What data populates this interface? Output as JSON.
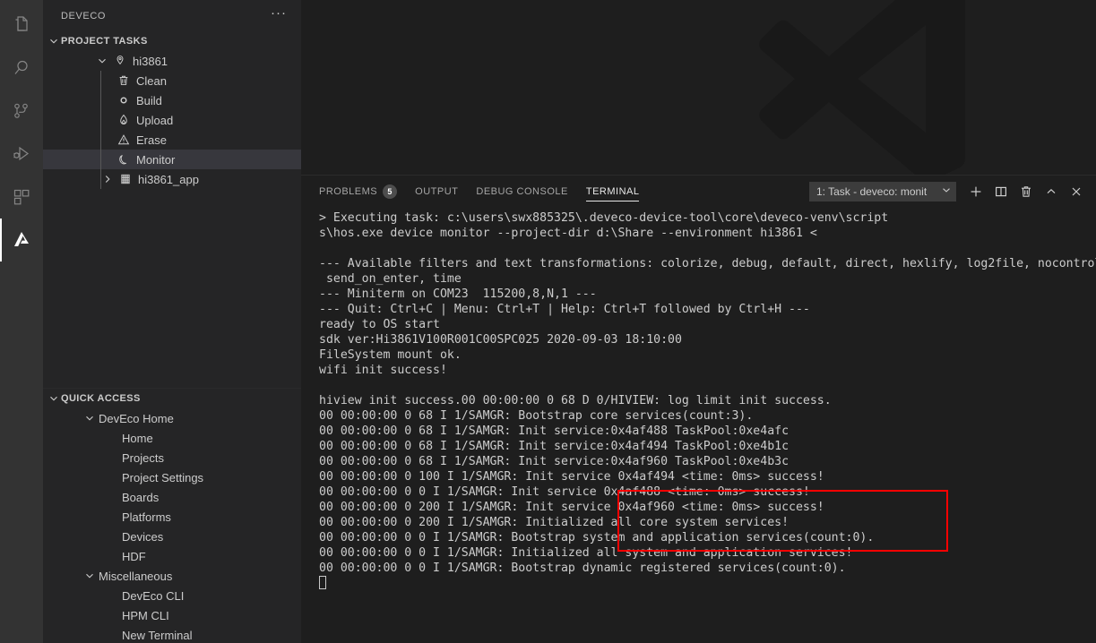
{
  "activitybar": {
    "items": [
      {
        "name": "explorer-icon",
        "title": "Explorer"
      },
      {
        "name": "search-icon",
        "title": "Search"
      },
      {
        "name": "source-control-icon",
        "title": "Source Control"
      },
      {
        "name": "run-and-debug-icon",
        "title": "Run and Debug"
      },
      {
        "name": "extensions-icon",
        "title": "Extensions"
      },
      {
        "name": "deveco-icon",
        "title": "DevEco",
        "active": true
      }
    ]
  },
  "sidebar": {
    "title": "DEVECO",
    "more_actions": "···",
    "project_tasks": {
      "header": "PROJECT TASKS",
      "root": {
        "label": "hi3861",
        "icon": "location-pin-icon"
      },
      "tasks": [
        {
          "label": "Clean",
          "icon": "trash-icon"
        },
        {
          "label": "Build",
          "icon": "circle-icon"
        },
        {
          "label": "Upload",
          "icon": "flame-icon"
        },
        {
          "label": "Erase",
          "icon": "warning-triangle-icon"
        },
        {
          "label": "Monitor",
          "icon": "moon-icon",
          "selected": true
        }
      ],
      "app_node": {
        "label": "hi3861_app",
        "icon": "chip-icon"
      }
    },
    "quick_access": {
      "header": "QUICK ACCESS",
      "groups": [
        {
          "label": "DevEco Home",
          "items": [
            "Home",
            "Projects",
            "Project Settings",
            "Boards",
            "Platforms",
            "Devices",
            "HDF"
          ]
        },
        {
          "label": "Miscellaneous",
          "items": [
            "DevEco CLI",
            "HPM CLI",
            "New Terminal"
          ]
        }
      ]
    }
  },
  "panel": {
    "tabs": [
      {
        "label": "PROBLEMS",
        "badge": "5",
        "active": false
      },
      {
        "label": "OUTPUT",
        "badge": null,
        "active": false
      },
      {
        "label": "DEBUG CONSOLE",
        "badge": null,
        "active": false
      },
      {
        "label": "TERMINAL",
        "badge": null,
        "active": true
      }
    ],
    "terminal_select": "1: Task - deveco: monit",
    "actions": [
      {
        "name": "new-terminal-icon",
        "label": "+"
      },
      {
        "name": "split-terminal-icon",
        "label": "◫"
      },
      {
        "name": "kill-terminal-icon",
        "label": "🗑"
      },
      {
        "name": "maximize-panel-icon",
        "label": "^"
      },
      {
        "name": "close-panel-icon",
        "label": "×"
      }
    ]
  },
  "terminal": {
    "lines": [
      "> Executing task: c:\\users\\swx885325\\.deveco-device-tool\\core\\deveco-venv\\script",
      "s\\hos.exe device monitor --project-dir d:\\Share --environment hi3861 <",
      "",
      "--- Available filters and text transformations: colorize, debug, default, direct, hexlify, log2file, nocontrol, printable,",
      " send_on_enter, time",
      "--- Miniterm on COM23  115200,8,N,1 ---",
      "--- Quit: Ctrl+C | Menu: Ctrl+T | Help: Ctrl+T followed by Ctrl+H ---",
      "ready to OS start",
      "sdk ver:Hi3861V100R001C00SPC025 2020-09-03 18:10:00",
      "FileSystem mount ok.",
      "wifi init success!",
      "",
      "hiview init success.00 00:00:00 0 68 D 0/HIVIEW: log limit init success.",
      "00 00:00:00 0 68 I 1/SAMGR: Bootstrap core services(count:3).",
      "00 00:00:00 0 68 I 1/SAMGR: Init service:0x4af488 TaskPool:0xe4afc",
      "00 00:00:00 0 68 I 1/SAMGR: Init service:0x4af494 TaskPool:0xe4b1c",
      "00 00:00:00 0 68 I 1/SAMGR: Init service:0x4af960 TaskPool:0xe4b3c",
      "00 00:00:00 0 100 I 1/SAMGR: Init service 0x4af494 <time: 0ms> success!",
      "00 00:00:00 0 0 I 1/SAMGR: Init service 0x4af488 <time: 0ms> success!",
      "00 00:00:00 0 200 I 1/SAMGR: Init service 0x4af960 <time: 0ms> success!",
      "00 00:00:00 0 200 I 1/SAMGR: Initialized all core system services!",
      "00 00:00:00 0 0 I 1/SAMGR: Bootstrap system and application services(count:0).",
      "00 00:00:00 0 0 I 1/SAMGR: Initialized all system and application services!",
      "00 00:00:00 0 0 I 1/SAMGR: Bootstrap dynamic registered services(count:0)."
    ],
    "highlight_annotation": {
      "color": "#ff0000",
      "lines": [
        "ready to OS start",
        "sdk ver:Hi3861V100R001C00SPC025 2020-09-03 18:10:00",
        "FileSystem mount ok.",
        "wifi init success!"
      ]
    }
  },
  "colors": {
    "activitybar_bg": "#333333",
    "sidebar_bg": "#252526",
    "editor_bg": "#1e1e1e",
    "selection_bg": "#37373d",
    "accent": "#ffffff",
    "annotation_red": "#ff0000",
    "text": "#cccccc"
  }
}
